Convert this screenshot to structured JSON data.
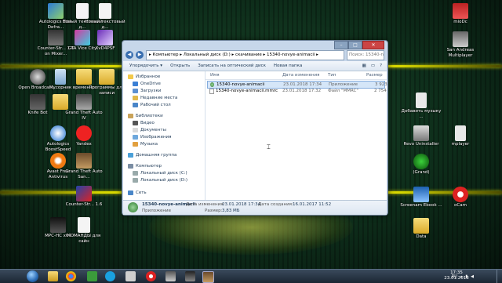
{
  "desktop_icons_left": [
    {
      "label": "Autologics Disk Defra..."
    },
    {
      "label": "Новый текстовый д..."
    },
    {
      "label": "Новый текстовый д..."
    },
    {
      "label": "Counter-Str... 1.6 on Mixer..."
    },
    {
      "label": "GTA Vice City"
    },
    {
      "label": "XvD4PSF"
    },
    {
      "label": "Open Broadcast..."
    },
    {
      "label": "Мусорник"
    },
    {
      "label": "временно"
    },
    {
      "label": "Программы для записи"
    },
    {
      "label": "Knife Bot"
    },
    {
      "label": ""
    },
    {
      "label": "Grand Theft Auto IV"
    },
    {
      "label": "Autologics BoostSpeed"
    },
    {
      "label": "Yandex"
    },
    {
      "label": "Avast Free Antivirus"
    },
    {
      "label": "Grand Theft Auto San..."
    },
    {
      "label": "Counter-Str... 1.6"
    },
    {
      "label": "MPC-HC x64"
    },
    {
      "label": "КОМАНДЫ для сайн"
    }
  ],
  "desktop_icons_right": [
    {
      "label": "mioDc"
    },
    {
      "label": "San Andreas Multiplayer"
    },
    {
      "label": "Добавить музыку ..."
    },
    {
      "label": "Revo Uninstaller"
    },
    {
      "label": "mplayer"
    },
    {
      "label": "(Grand)"
    },
    {
      "label": "Screenam Ebook ..."
    },
    {
      "label": "oCam"
    },
    {
      "label": "Data"
    }
  ],
  "window": {
    "address_path": "▸ Компьютер ▸ Локальный диск (D:) ▸ скачивание ▸ 15340-novye-animacii ▸",
    "search_placeholder": "Поиск: 15340-novye-ani...",
    "toolbar": {
      "organize": "Упорядочить ▾",
      "open": "Открыть",
      "burn": "Записать на оптический диск",
      "new_folder": "Новая папка"
    },
    "nav": {
      "favorites": "Избранное",
      "onedrive": "OneDrive",
      "downloads": "Загрузки",
      "recent": "Недавние места",
      "desktop": "Рабочий стол",
      "libraries": "Библиотеки",
      "video": "Видео",
      "documents": "Документы",
      "pictures": "Изображения",
      "music": "Музыка",
      "homegroup": "Домашняя группа",
      "computer": "Компьютер",
      "drive_c": "Локальный диск (C:)",
      "drive_d": "Локальный диск (D:)",
      "network": "Сеть"
    },
    "columns": {
      "name": "Имя",
      "date": "Дата изменения",
      "type": "Тип",
      "size": "Размер"
    },
    "files": [
      {
        "name": "15340-novye-animacii",
        "date": "23.01.2018 17:34",
        "type": "Приложение",
        "size": "3 923"
      },
      {
        "name": "15340-novye-animacii.mmrc",
        "date": "23.01.2018 17:32",
        "type": "Файл \"MMRC\"",
        "size": "2 754"
      }
    ],
    "details": {
      "name": "15340-novye-animacii",
      "type": "Приложение",
      "modified_label": "Дата изменения:",
      "modified": "23.01.2018 17:34",
      "size_label": "Размер:",
      "size": "3,83 МБ",
      "created_label": "Дата создания:",
      "created": "16.01.2017 11:52"
    }
  },
  "taskbar": {
    "time": "17:35",
    "date": "23.01.2018",
    "lang": "RU"
  }
}
